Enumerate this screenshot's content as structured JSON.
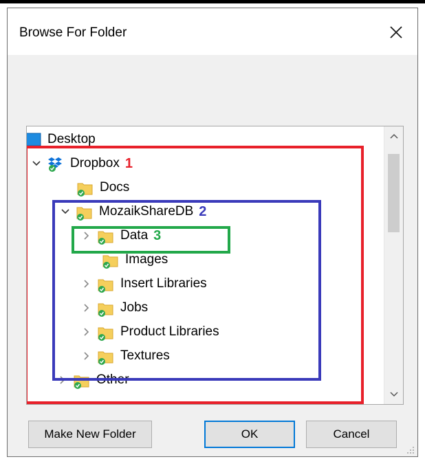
{
  "dialog": {
    "title": "Browse For Folder",
    "close_icon": "close-icon"
  },
  "tree": {
    "items": [
      {
        "label": "Desktop",
        "icon": "desktop-icon",
        "expander": "none"
      },
      {
        "label": "Dropbox",
        "icon": "dropbox-icon",
        "expander": "expanded",
        "annotation": "1"
      },
      {
        "label": "Docs",
        "icon": "synced-folder-icon",
        "expander": "none"
      },
      {
        "label": "MozaikShareDB",
        "icon": "synced-folder-icon",
        "expander": "expanded",
        "annotation": "2"
      },
      {
        "label": "Data",
        "icon": "synced-folder-icon",
        "expander": "collapsed",
        "annotation": "3"
      },
      {
        "label": "Images",
        "icon": "synced-folder-icon",
        "expander": "none"
      },
      {
        "label": "Insert Libraries",
        "icon": "synced-folder-icon",
        "expander": "collapsed"
      },
      {
        "label": "Jobs",
        "icon": "synced-folder-icon",
        "expander": "collapsed"
      },
      {
        "label": "Product Libraries",
        "icon": "synced-folder-icon",
        "expander": "collapsed"
      },
      {
        "label": "Textures",
        "icon": "synced-folder-icon",
        "expander": "collapsed"
      },
      {
        "label": "Other",
        "icon": "synced-folder-icon",
        "expander": "collapsed"
      }
    ],
    "highlight_colors": {
      "red": "#e8202a",
      "blue": "#3a3aba",
      "green": "#22a84a"
    }
  },
  "buttons": {
    "make_new_folder": "Make New Folder",
    "ok": "OK",
    "cancel": "Cancel"
  }
}
